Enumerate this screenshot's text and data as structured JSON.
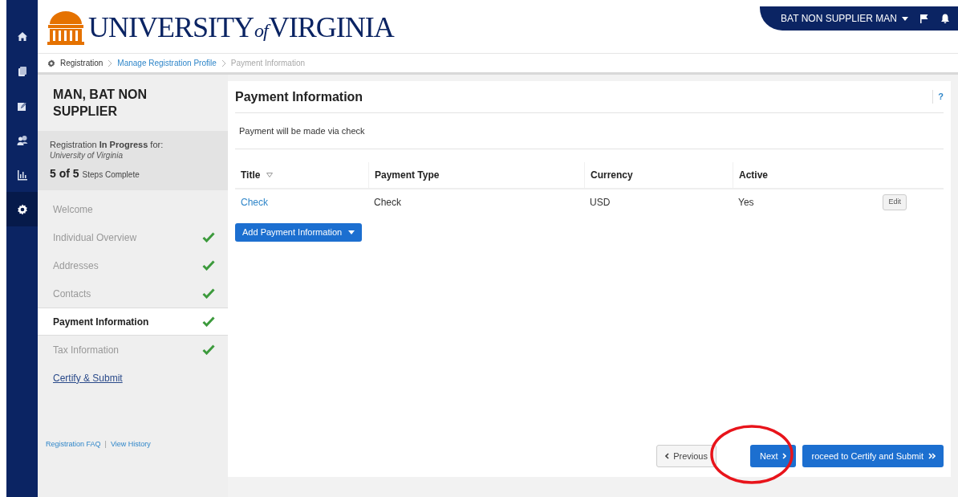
{
  "nav_rail": {
    "items": [
      {
        "selected": false
      },
      {
        "selected": false
      },
      {
        "selected": false
      },
      {
        "selected": false
      },
      {
        "selected": false
      },
      {
        "selected": true
      }
    ]
  },
  "header": {
    "logo": [
      "UNIVERSITY",
      "of",
      "VIRGINIA"
    ],
    "user_menu": "BAT NON SUPPLIER MAN"
  },
  "breadcrumb": [
    {
      "text": "Registration",
      "kind": "root"
    },
    {
      "text": "Manage Registration Profile",
      "kind": "link"
    },
    {
      "text": "Payment Information",
      "kind": "current"
    }
  ],
  "sidebar": {
    "name": "MAN, BAT NON SUPPLIER",
    "status": "Registration **In Progress** for:",
    "organization": "University of Virginia",
    "steps_done": "5 of 5",
    "steps_label": "Steps Complete",
    "steps": [
      {
        "label": "Welcome",
        "kind": "step",
        "checked": false,
        "selected": false
      },
      {
        "label": "Individual Overview",
        "kind": "step",
        "checked": true,
        "selected": false
      },
      {
        "label": "Addresses",
        "kind": "step",
        "checked": true,
        "selected": false
      },
      {
        "label": "Contacts",
        "kind": "step",
        "checked": true,
        "selected": false
      },
      {
        "label": "Payment Information",
        "kind": "step",
        "checked": true,
        "selected": true
      },
      {
        "label": "Tax Information",
        "kind": "step",
        "checked": true,
        "selected": false
      },
      {
        "label": "Certify & Submit",
        "kind": "link",
        "checked": false,
        "selected": false
      }
    ],
    "footer_links": [
      "Registration FAQ",
      "View History"
    ],
    "separator": "|"
  },
  "main": {
    "title": "Payment Information",
    "help": "?",
    "note": "Payment will be made via check",
    "table": {
      "columns": [
        {
          "label": "Title",
          "sortable": true
        },
        {
          "label": "Payment Type",
          "sortable": false
        },
        {
          "label": "Currency",
          "sortable": false
        },
        {
          "label": "Active",
          "sortable": false
        }
      ],
      "rows": [
        {
          "cells": [
            "Check",
            "Check",
            "USD",
            "Yes"
          ],
          "action": "Edit"
        }
      ]
    },
    "add_button": "Add Payment Information",
    "buttons": [
      {
        "label": "Previous",
        "kind": "back"
      },
      {
        "label": "Next",
        "kind": "next"
      },
      {
        "label": "roceed to Certify and Submit",
        "kind": "finish"
      }
    ]
  }
}
